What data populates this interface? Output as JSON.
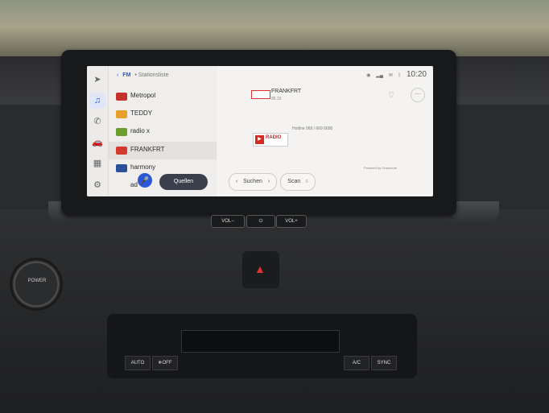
{
  "header": {
    "back_glyph": "‹",
    "band": "FM",
    "separator": "•",
    "title": "Stationsliste"
  },
  "status_bar": {
    "time": "10:20",
    "icons": [
      "location-icon",
      "signal-icon",
      "message-icon",
      "bluetooth-icon"
    ]
  },
  "rail": {
    "items": [
      {
        "name": "navigation",
        "icon": "navigation-arrow-icon",
        "glyph": "➤"
      },
      {
        "name": "media",
        "icon": "music-note-icon",
        "glyph": "♫",
        "active": true
      },
      {
        "name": "phone",
        "icon": "phone-icon",
        "glyph": "✆"
      },
      {
        "name": "vehicle",
        "icon": "car-icon",
        "glyph": "🚗"
      },
      {
        "name": "apps",
        "icon": "apps-grid-icon",
        "glyph": "▦"
      },
      {
        "name": "settings",
        "icon": "gear-icon",
        "glyph": "⚙"
      }
    ]
  },
  "stations": [
    {
      "label": "Metropol",
      "logo_color": "#c4302b"
    },
    {
      "label": "TEDDY",
      "logo_color": "#e7a02a"
    },
    {
      "label": "radio x",
      "logo_color": "#6a9f2e"
    },
    {
      "label": "FRANKFRT",
      "logo_color": "#d33b2f",
      "selected": true
    },
    {
      "label": "harmony",
      "logo_color": "#2c4f9a"
    },
    {
      "label": "ad",
      "logo_color": "#888888"
    }
  ],
  "controls": {
    "voice_glyph": "🎤",
    "quellen_label": "Quellen",
    "suchen_label": "Suchen",
    "suchen_prev": "‹",
    "suchen_next": "›",
    "scan_label": "Scan",
    "scan_glyph": "≡"
  },
  "now_playing": {
    "station": "FRANKFRT",
    "frequency": "95.15",
    "logo_text": "RADIO",
    "hotline": "Hotline 069 / 669 6690",
    "powered_by": "Powered by Gracenote",
    "favorite_glyph": "♡",
    "more_glyph": "···"
  },
  "hardware": {
    "vol_down": "VOL−",
    "power_glyph": "⏻",
    "vol_up": "VOL+",
    "power_button_label": "POWER",
    "climate": {
      "auto": "AUTO",
      "off": "❄OFF",
      "ac": "A/C",
      "sync": "SYNC"
    }
  },
  "colors": {
    "accent": "#2a58d6",
    "screen_bg": "#f1f0ee",
    "quellen_bg": "#3a3f4b"
  }
}
